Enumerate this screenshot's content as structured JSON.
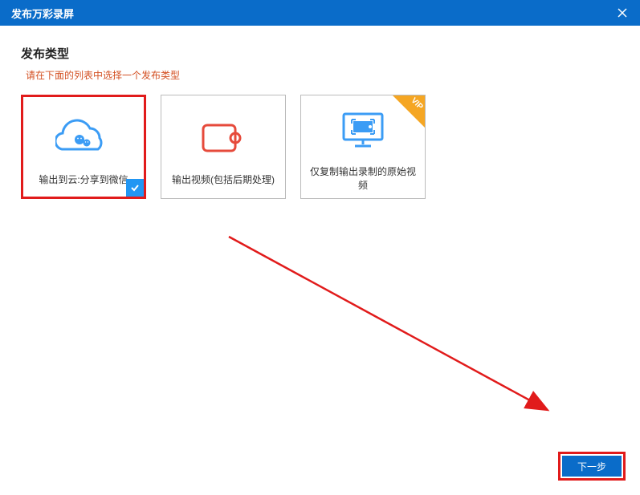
{
  "header": {
    "title": "发布万彩录屏"
  },
  "section": {
    "title": "发布类型",
    "subtitle": "请在下面的列表中选择一个发布类型"
  },
  "options": {
    "cloud": {
      "label": "输出到云:分享到微信"
    },
    "video": {
      "label": "输出视频(包括后期处理)"
    },
    "copy": {
      "label": "仅复制输出录制的原始视频",
      "badge": "VIP"
    }
  },
  "footer": {
    "next": "下一步"
  }
}
